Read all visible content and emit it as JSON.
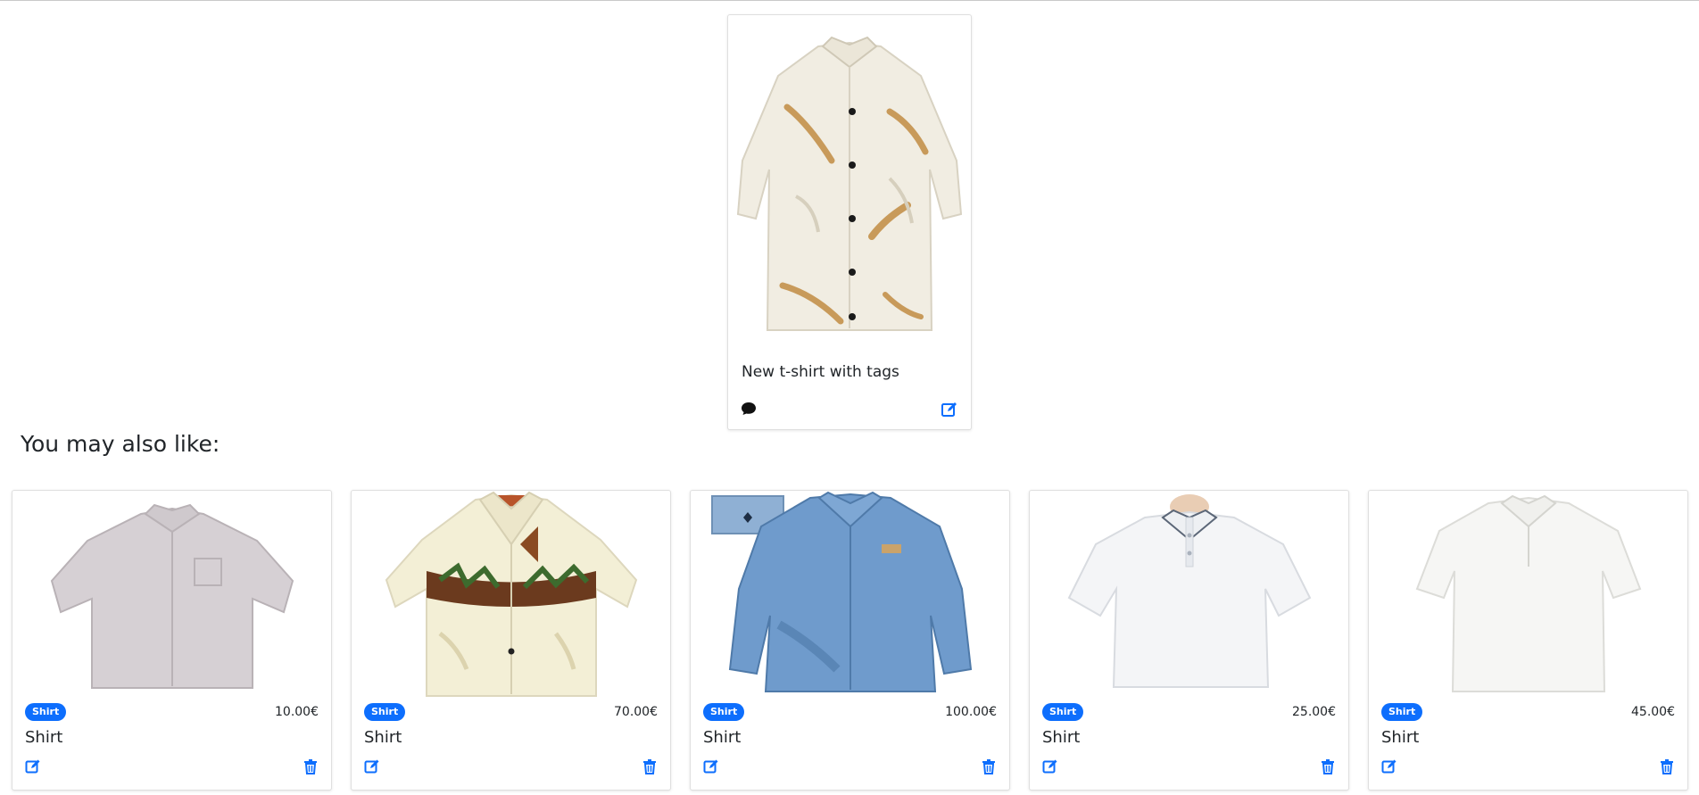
{
  "main_product": {
    "title": "New t-shirt with tags",
    "image_alt": "cream shirt with feather print",
    "icons": {
      "comment": "comment-icon",
      "edit": "edit-icon"
    }
  },
  "recommendations": {
    "heading": "You may also like:",
    "items": [
      {
        "badge": "Shirt",
        "price": "10.00€",
        "title": "Shirt",
        "image_alt": "lilac short-sleeve button shirt"
      },
      {
        "badge": "Shirt",
        "price": "70.00€",
        "title": "Shirt",
        "image_alt": "cream hawaiian shirt with canoe print"
      },
      {
        "badge": "Shirt",
        "price": "100.00€",
        "title": "Shirt",
        "image_alt": "blue denim long-sleeve shirt"
      },
      {
        "badge": "Shirt",
        "price": "25.00€",
        "title": "Shirt",
        "image_alt": "white polo shirt on mannequin"
      },
      {
        "badge": "Shirt",
        "price": "45.00€",
        "title": "Shirt",
        "image_alt": "white polo shirt"
      }
    ]
  },
  "colors": {
    "accent": "#0d6efd",
    "text": "#212529"
  }
}
